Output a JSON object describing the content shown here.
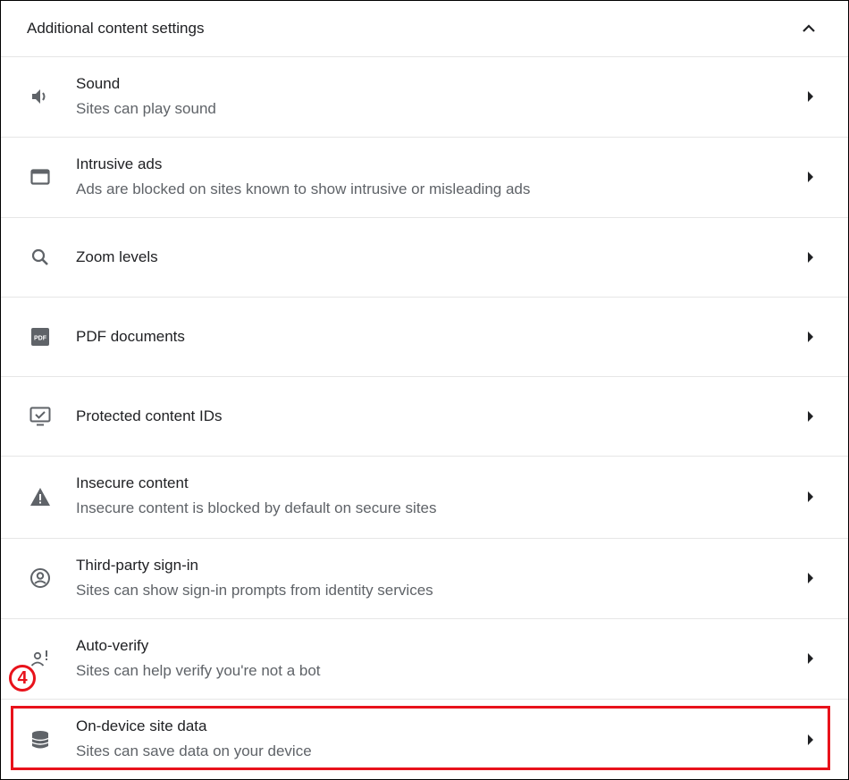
{
  "section": {
    "title": "Additional content settings",
    "collapse_icon": "chevron-up-icon"
  },
  "rows": [
    {
      "title": "Sound",
      "subtitle": "Sites can play sound",
      "icon": "speaker-icon"
    },
    {
      "title": "Intrusive ads",
      "subtitle": "Ads are blocked on sites known to show intrusive or misleading ads",
      "icon": "browser-window-icon"
    },
    {
      "title": "Zoom levels",
      "subtitle": "",
      "icon": "magnifier-icon"
    },
    {
      "title": "PDF documents",
      "subtitle": "",
      "icon": "pdf-icon"
    },
    {
      "title": "Protected content IDs",
      "subtitle": "",
      "icon": "monitor-check-icon"
    },
    {
      "title": "Insecure content",
      "subtitle": "Insecure content is blocked by default on secure sites",
      "icon": "warning-icon"
    },
    {
      "title": "Third-party sign-in",
      "subtitle": "Sites can show sign-in prompts from identity services",
      "icon": "account-circle-icon"
    },
    {
      "title": "Auto-verify",
      "subtitle": "Sites can help verify you're not a bot",
      "icon": "person-alert-icon"
    },
    {
      "title": "On-device site data",
      "subtitle": "Sites can save data on your device",
      "icon": "database-icon"
    }
  ],
  "annotation": {
    "step_label": "4",
    "color": "#e8121b"
  }
}
